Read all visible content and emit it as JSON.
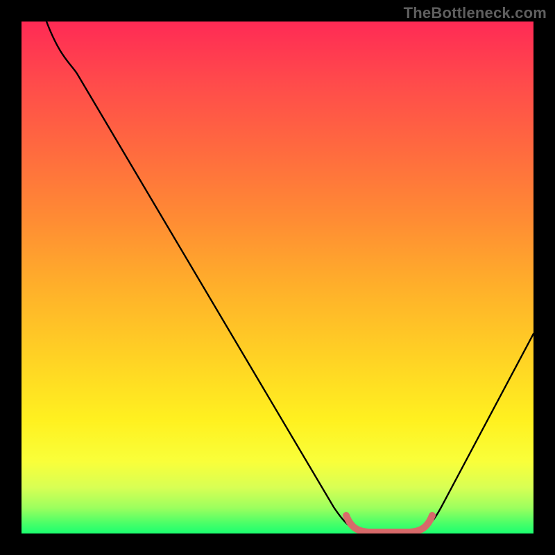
{
  "watermark": "TheBottleneck.com",
  "chart_data": {
    "type": "line",
    "title": "",
    "xlabel": "",
    "ylabel": "",
    "xlim": [
      0,
      100
    ],
    "ylim": [
      0,
      100
    ],
    "series": [
      {
        "name": "bottleneck-curve",
        "x": [
          5,
          10,
          20,
          30,
          40,
          50,
          60,
          65,
          68,
          72,
          75,
          78,
          82,
          90,
          100
        ],
        "values": [
          100,
          95,
          80,
          64,
          48,
          32,
          16,
          6,
          1,
          0,
          0,
          1,
          6,
          20,
          40
        ]
      },
      {
        "name": "optimal-range-marker",
        "x": [
          65,
          68,
          72,
          75,
          78
        ],
        "values": [
          3,
          0.5,
          0,
          0.5,
          3
        ]
      }
    ],
    "gradient_stops": [
      {
        "pos": 0,
        "color": "#ff2a55"
      },
      {
        "pos": 50,
        "color": "#ffb02a"
      },
      {
        "pos": 80,
        "color": "#fff120"
      },
      {
        "pos": 100,
        "color": "#1bff70"
      }
    ],
    "marker_color": "#d86a6a"
  }
}
